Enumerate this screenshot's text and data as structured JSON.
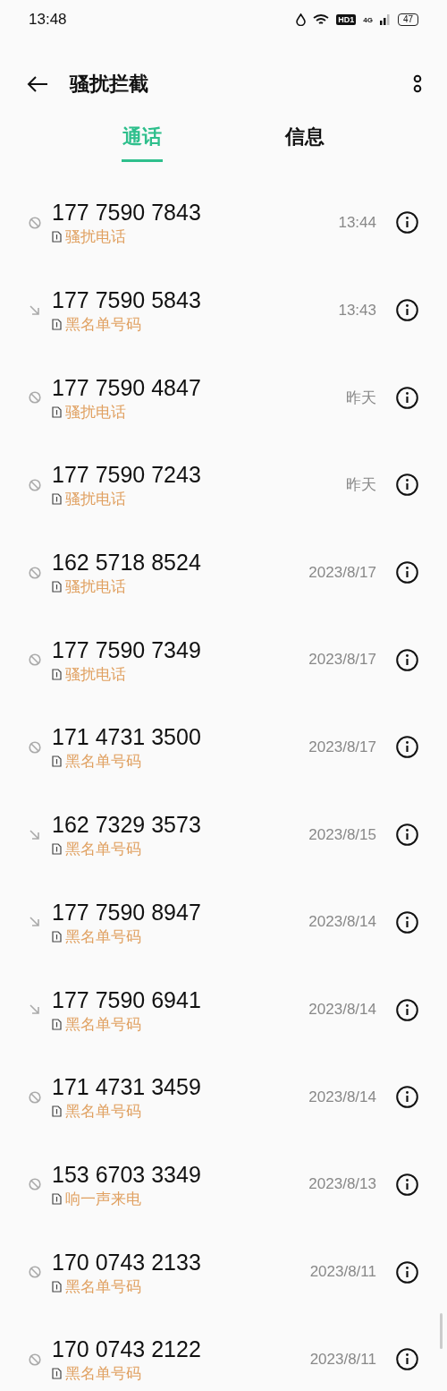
{
  "status_bar": {
    "time": "13:48",
    "hd": "HD1",
    "network": "4G",
    "battery": "47"
  },
  "header": {
    "title": "骚扰拦截"
  },
  "tabs": [
    {
      "label": "通话",
      "selected": true
    },
    {
      "label": "信息",
      "selected": false
    }
  ],
  "calls": [
    {
      "kind": "blocked",
      "number": "177 7590 7843",
      "tag": "骚扰电话",
      "time": "13:44"
    },
    {
      "kind": "incoming",
      "number": "177 7590 5843",
      "tag": "黑名单号码",
      "time": "13:43"
    },
    {
      "kind": "blocked",
      "number": "177 7590 4847",
      "tag": "骚扰电话",
      "time": "昨天"
    },
    {
      "kind": "blocked",
      "number": "177 7590 7243",
      "tag": "骚扰电话",
      "time": "昨天"
    },
    {
      "kind": "blocked",
      "number": "162 5718 8524",
      "tag": "骚扰电话",
      "time": "2023/8/17"
    },
    {
      "kind": "blocked",
      "number": "177 7590 7349",
      "tag": "骚扰电话",
      "time": "2023/8/17"
    },
    {
      "kind": "blocked",
      "number": "171 4731 3500",
      "tag": "黑名单号码",
      "time": "2023/8/17"
    },
    {
      "kind": "incoming",
      "number": "162 7329 3573",
      "tag": "黑名单号码",
      "time": "2023/8/15"
    },
    {
      "kind": "incoming",
      "number": "177 7590 8947",
      "tag": "黑名单号码",
      "time": "2023/8/14"
    },
    {
      "kind": "incoming",
      "number": "177 7590 6941",
      "tag": "黑名单号码",
      "time": "2023/8/14"
    },
    {
      "kind": "blocked",
      "number": "171 4731 3459",
      "tag": "黑名单号码",
      "time": "2023/8/14"
    },
    {
      "kind": "blocked",
      "number": "153 6703 3349",
      "tag": "响一声来电",
      "time": "2023/8/13"
    },
    {
      "kind": "blocked",
      "number": "170 0743 2133",
      "tag": "黑名单号码",
      "time": "2023/8/11"
    },
    {
      "kind": "blocked",
      "number": "170 0743 2122",
      "tag": "黑名单号码",
      "time": "2023/8/11"
    }
  ]
}
